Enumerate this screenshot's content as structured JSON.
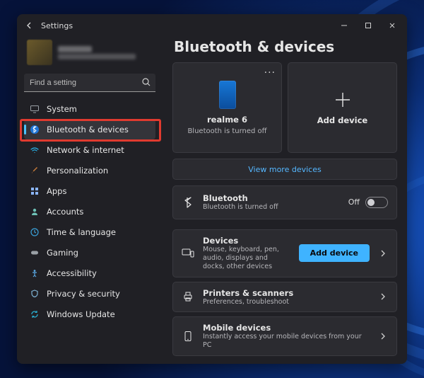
{
  "window": {
    "title": "Settings"
  },
  "search": {
    "placeholder": "Find a setting"
  },
  "sidebar": {
    "items": [
      {
        "label": "System"
      },
      {
        "label": "Bluetooth & devices"
      },
      {
        "label": "Network & internet"
      },
      {
        "label": "Personalization"
      },
      {
        "label": "Apps"
      },
      {
        "label": "Accounts"
      },
      {
        "label": "Time & language"
      },
      {
        "label": "Gaming"
      },
      {
        "label": "Accessibility"
      },
      {
        "label": "Privacy & security"
      },
      {
        "label": "Windows Update"
      }
    ],
    "active_index": 1
  },
  "page": {
    "title": "Bluetooth & devices"
  },
  "device_card": {
    "name": "realme 6",
    "status": "Bluetooth is turned off",
    "more": "···"
  },
  "add_card": {
    "label": "Add device"
  },
  "view_more": "View more devices",
  "bluetooth_row": {
    "title": "Bluetooth",
    "sub": "Bluetooth is turned off",
    "toggle_label": "Off",
    "toggle_on": false
  },
  "devices_row": {
    "title": "Devices",
    "sub": "Mouse, keyboard, pen, audio, displays and docks, other devices",
    "button": "Add device"
  },
  "printers_row": {
    "title": "Printers & scanners",
    "sub": "Preferences, troubleshoot"
  },
  "mobile_row": {
    "title": "Mobile devices",
    "sub": "Instantly access your mobile devices from your PC"
  },
  "colors": {
    "accent": "#4cc2ff",
    "highlight": "#e03a2f",
    "button": "#3fb3ff"
  }
}
